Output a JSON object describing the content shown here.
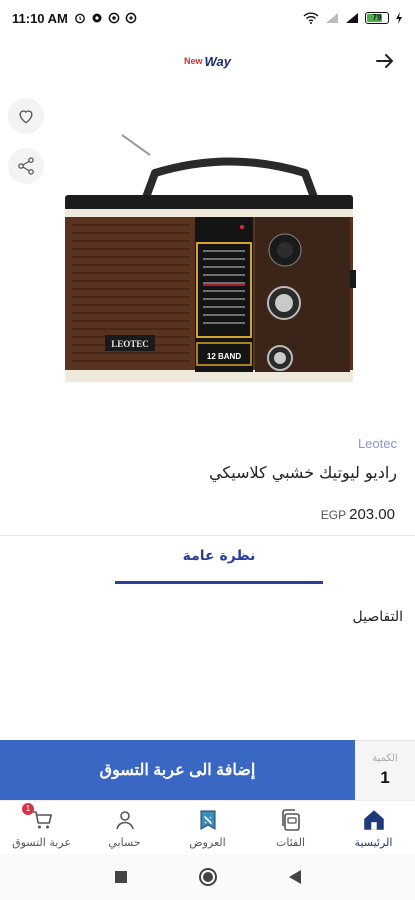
{
  "status_bar": {
    "time": "11:10 AM",
    "battery": "79"
  },
  "app_bar": {
    "logo_new": "New",
    "logo_way": "Way"
  },
  "product": {
    "brand": "Leotec",
    "title": "راديو ليوتيك خشبي كلاسيكي",
    "price": "203.00",
    "currency": "EGP",
    "image_brand_label": "LEOTEC",
    "image_band_label": "12 BAND"
  },
  "tabs": {
    "overview": "نظرة عامة"
  },
  "details": {
    "label": "التفاصيل"
  },
  "cart_bar": {
    "add_label": "إضافة الى عربة التسوق",
    "qty_label": "الكمية",
    "qty_value": "1"
  },
  "bottom_nav": {
    "items": [
      {
        "label": "الرئيسية",
        "icon": "home-icon"
      },
      {
        "label": "الفئات",
        "icon": "categories-icon"
      },
      {
        "label": "العروض",
        "icon": "offers-icon"
      },
      {
        "label": "حسابي",
        "icon": "account-icon"
      },
      {
        "label": "عربة التسوق",
        "icon": "cart-icon",
        "badge": "1"
      }
    ]
  },
  "colors": {
    "primary": "#3a67c4",
    "tab_accent": "#2c3e9c",
    "brand_text": "#8a97c9",
    "badge": "#d6334a"
  }
}
